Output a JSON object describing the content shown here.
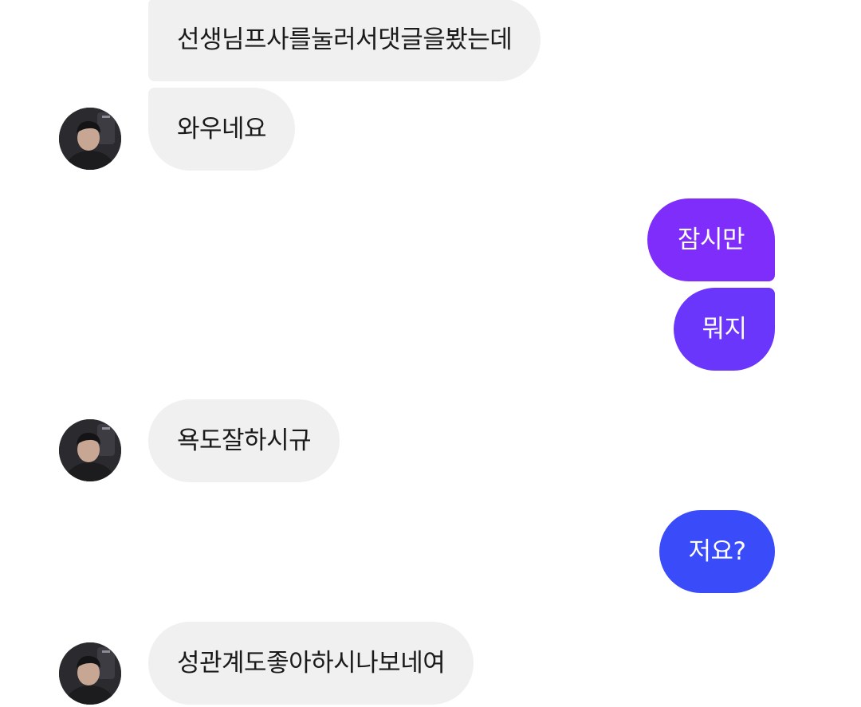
{
  "messages": [
    {
      "from": "them",
      "text": "선생님프사를눌러서댓글을봤는데"
    },
    {
      "from": "them",
      "text": "와우네요"
    },
    {
      "from": "me",
      "text": "잠시만"
    },
    {
      "from": "me",
      "text": "뭐지"
    },
    {
      "from": "them",
      "text": "욕도잘하시규"
    },
    {
      "from": "me",
      "text": "저요?"
    },
    {
      "from": "them",
      "text": "성관계도좋아하시나보네여"
    }
  ],
  "colors": {
    "incoming_bubble": "#f0f0f0",
    "incoming_text": "#1a1a1a",
    "outgoing_gradient": [
      "#7f2dfb",
      "#3a4bfa"
    ],
    "outgoing_text": "#ffffff"
  },
  "icons": {
    "sender_avatar": "profile-photo"
  }
}
